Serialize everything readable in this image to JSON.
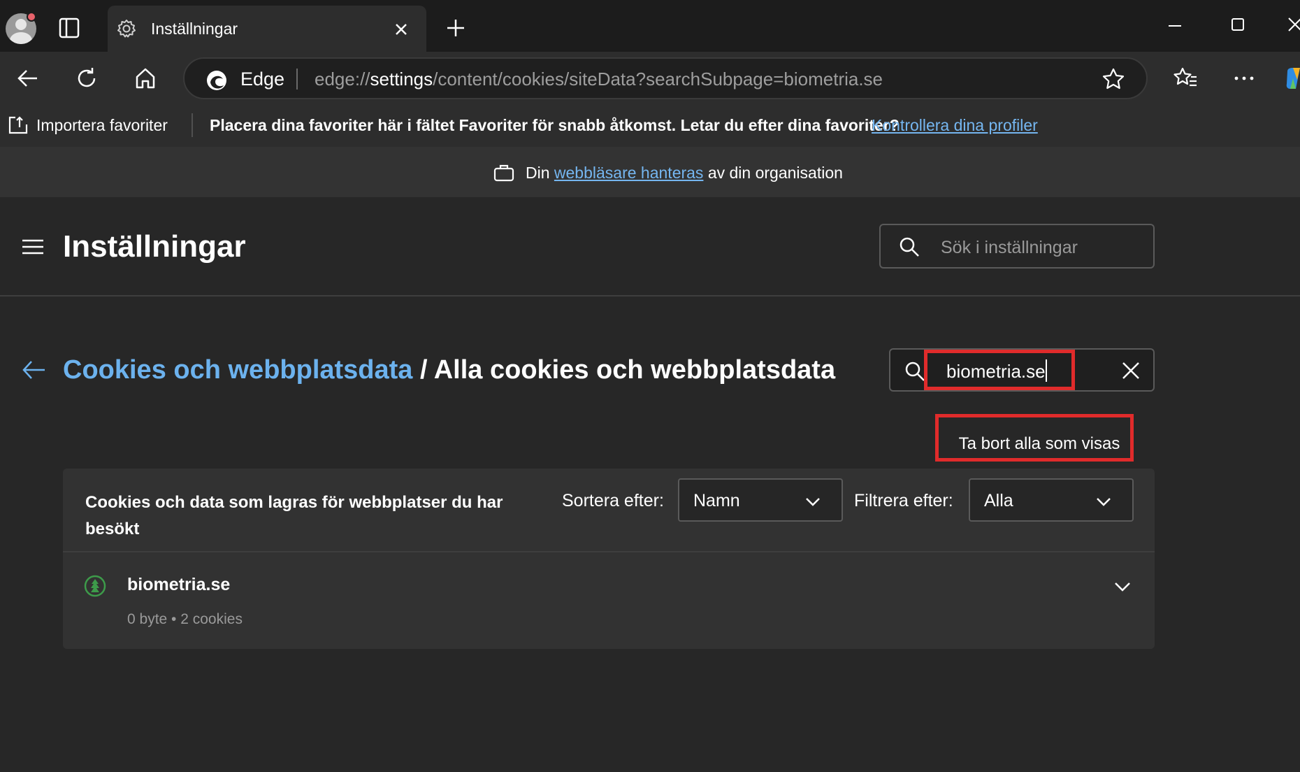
{
  "tab": {
    "title": "Inställningar",
    "icon": "gear-icon"
  },
  "toolbar": {
    "omnibox_label": "Edge",
    "url_scheme": "edge://",
    "url_host": "settings",
    "url_path": "/content/cookies/siteData?searchSubpage=biometria.se"
  },
  "favorites_bar": {
    "import_label": "Importera favoriter",
    "message": "Placera dina favoriter här i fältet Favoriter för snabb åtkomst. Letar du efter dina favoriter?",
    "link": "Kontrollera dina profiler"
  },
  "managed_bar": {
    "prefix": "Din",
    "link": "webbläsare hanteras",
    "suffix": "av din organisation"
  },
  "settings": {
    "title": "Inställningar",
    "search_placeholder": "Sök i inställningar"
  },
  "breadcrumb": {
    "parent": "Cookies och webbplatsdata",
    "separator": " / ",
    "current": "Alla cookies och webbplatsdata"
  },
  "site_search": {
    "value": "biometria.se"
  },
  "remove_all_label": "Ta bort alla som visas",
  "list": {
    "header": "Cookies och data som lagras för webbplatser du har besökt",
    "sort_label": "Sortera efter:",
    "sort_value": "Namn",
    "filter_label": "Filtrera efter:",
    "filter_value": "Alla",
    "items": [
      {
        "name": "biometria.se",
        "meta": "0 byte • 2 cookies"
      }
    ]
  },
  "colors": {
    "accent_link": "#6cb2ee",
    "highlight": "#e02b2b",
    "background": "#272727"
  }
}
